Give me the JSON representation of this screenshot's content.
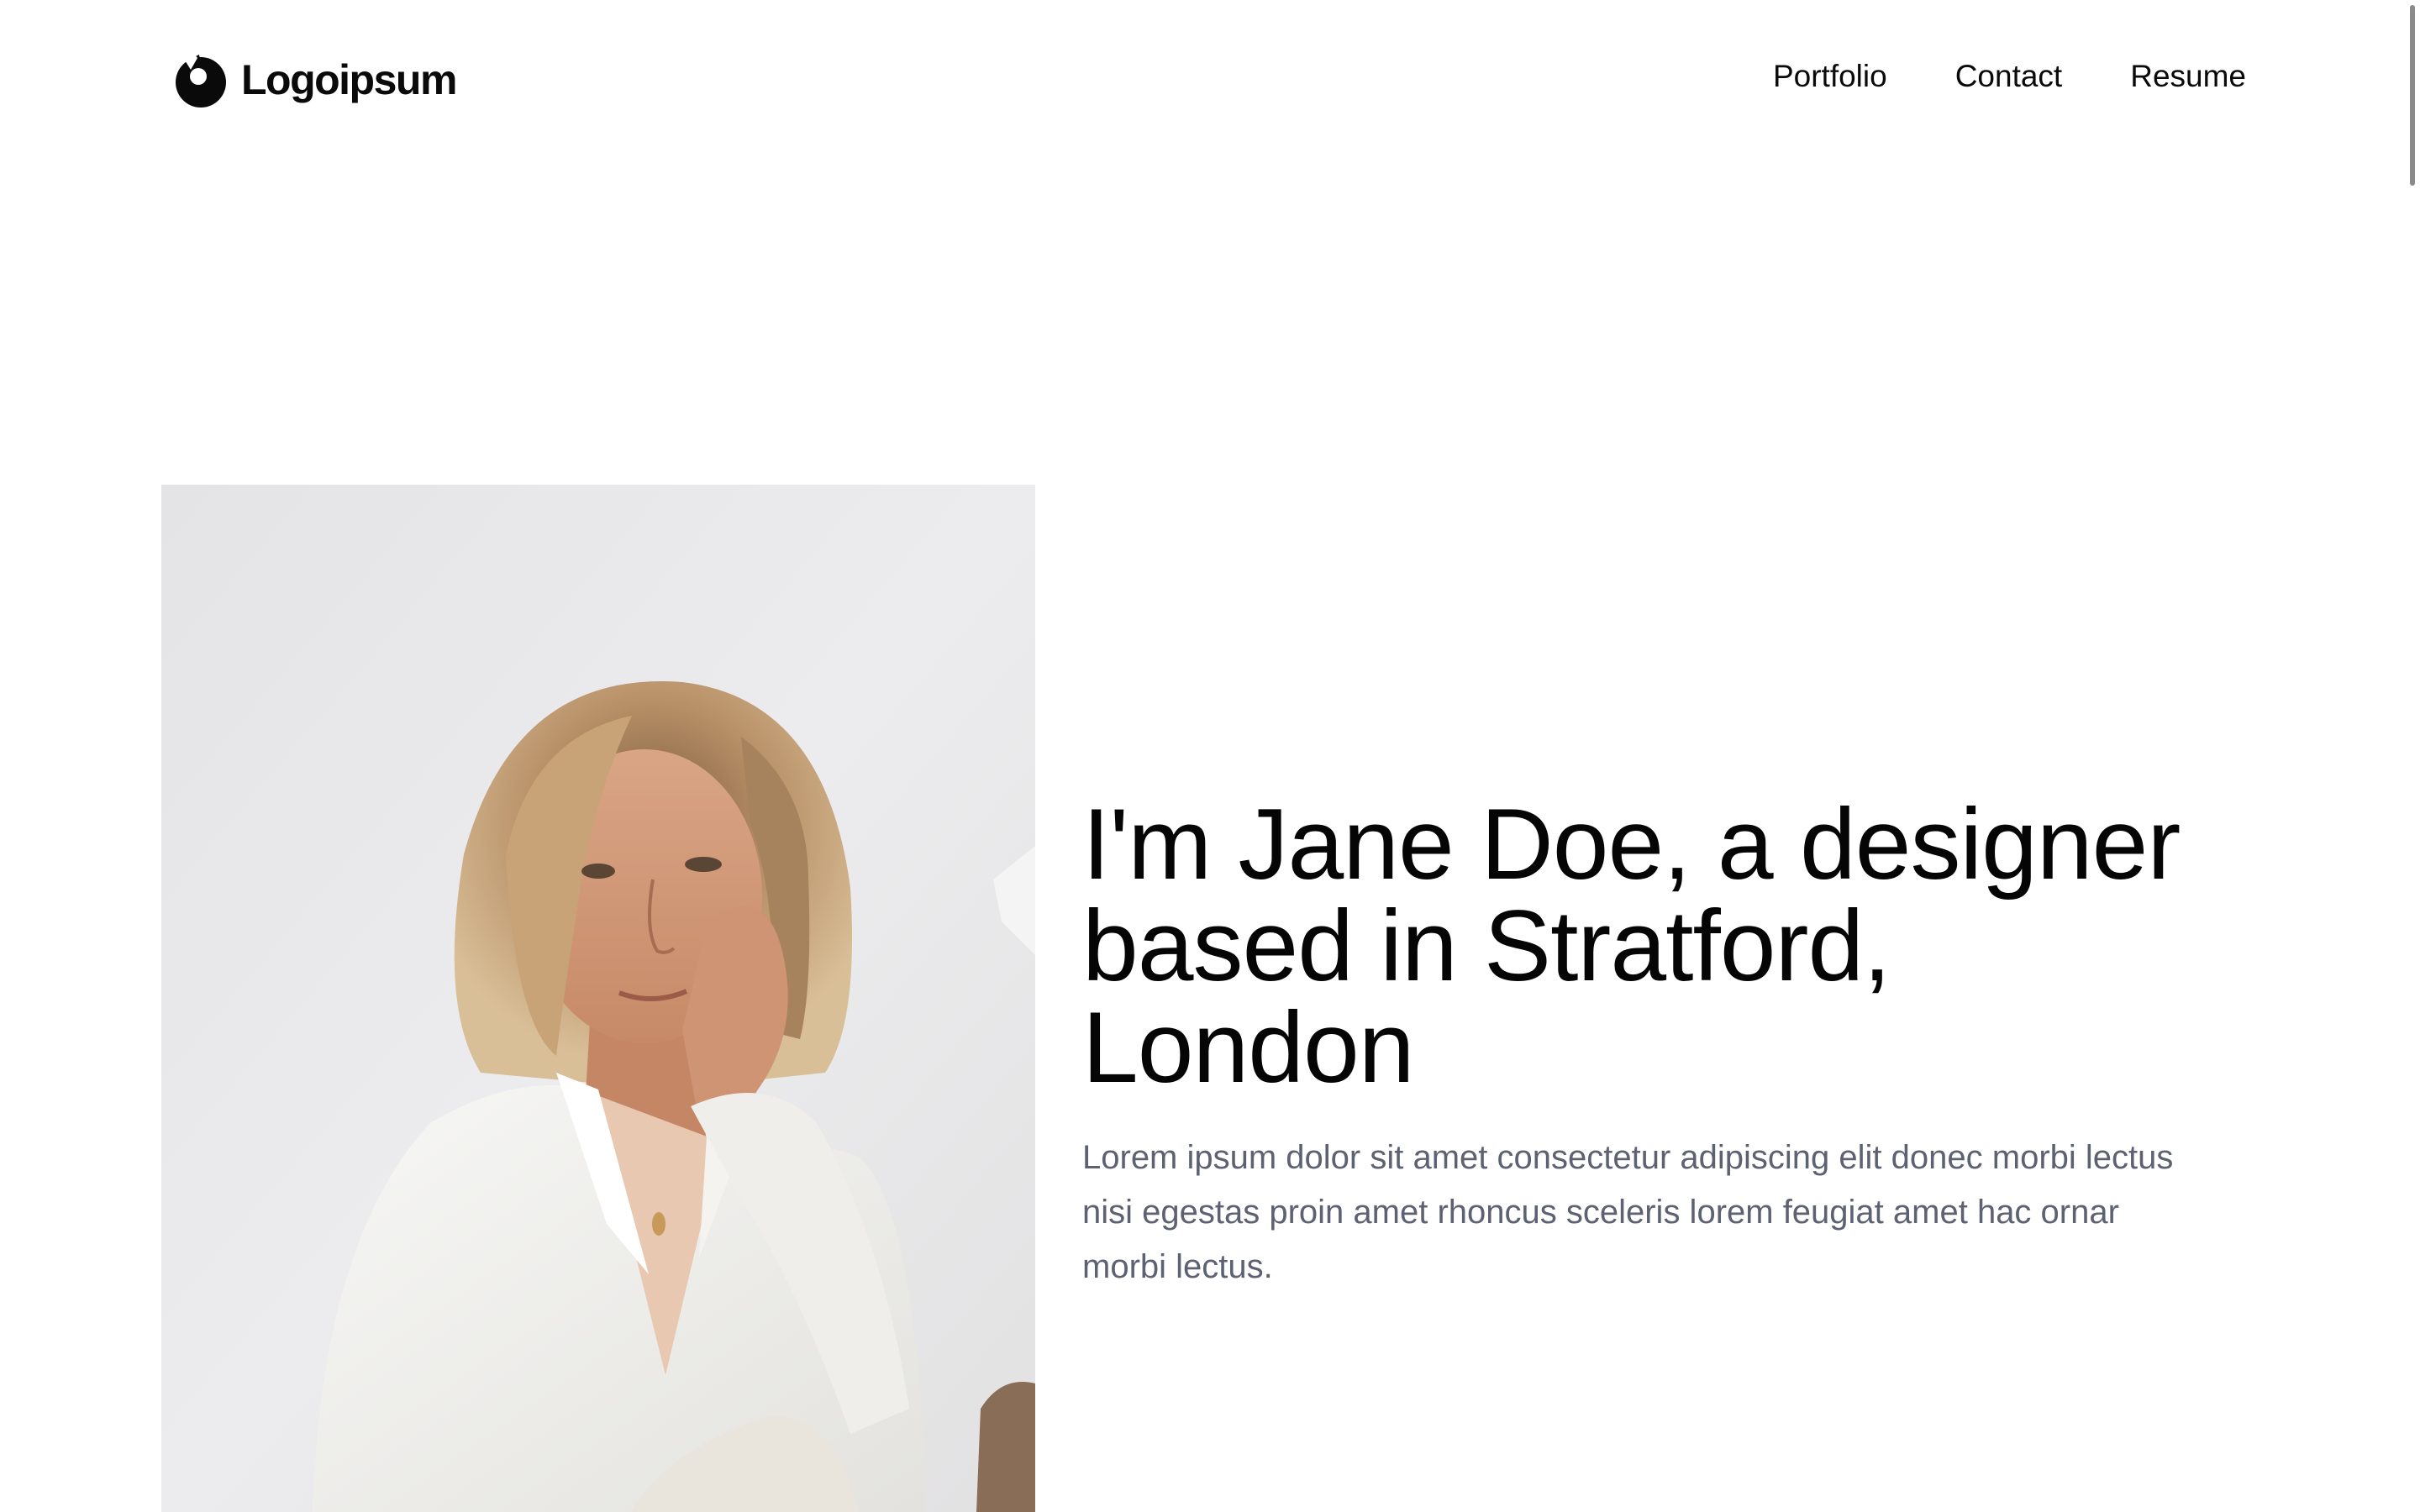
{
  "header": {
    "logo_text": "Logoipsum",
    "logo_icon": "logoipsum-mark-icon",
    "nav": [
      {
        "label": "Portfolio"
      },
      {
        "label": "Contact"
      },
      {
        "label": "Resume"
      }
    ]
  },
  "hero": {
    "title": "I'm Jane Doe, a designer based in Stratford, London",
    "description": "Lorem ipsum dolor sit amet consectetur adipiscing elit donec morbi lectus nisi egestas proin amet rhoncus sceleris lorem feugiat amet hac ornar morbi lectus."
  },
  "colors": {
    "background": "#ffffff",
    "text_primary": "#050505",
    "text_muted": "#5d6273"
  }
}
